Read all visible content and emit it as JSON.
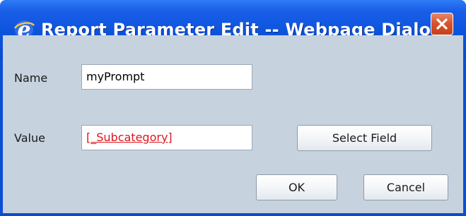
{
  "window": {
    "title": "Report Parameter Edit -- Webpage Dialog",
    "icon": "ie-e-icon",
    "close_icon": "close-icon"
  },
  "form": {
    "name_label": "Name",
    "name_value": "myPrompt",
    "value_label": "Value",
    "value_value": "[_Subcategory]"
  },
  "buttons": {
    "select_field": "Select Field",
    "ok": "OK",
    "cancel": "Cancel"
  },
  "colors": {
    "titlebar": "#0c53dc",
    "dialog_background": "#c6d2de",
    "close_button": "#d8552e",
    "link_value": "#e0141e"
  }
}
